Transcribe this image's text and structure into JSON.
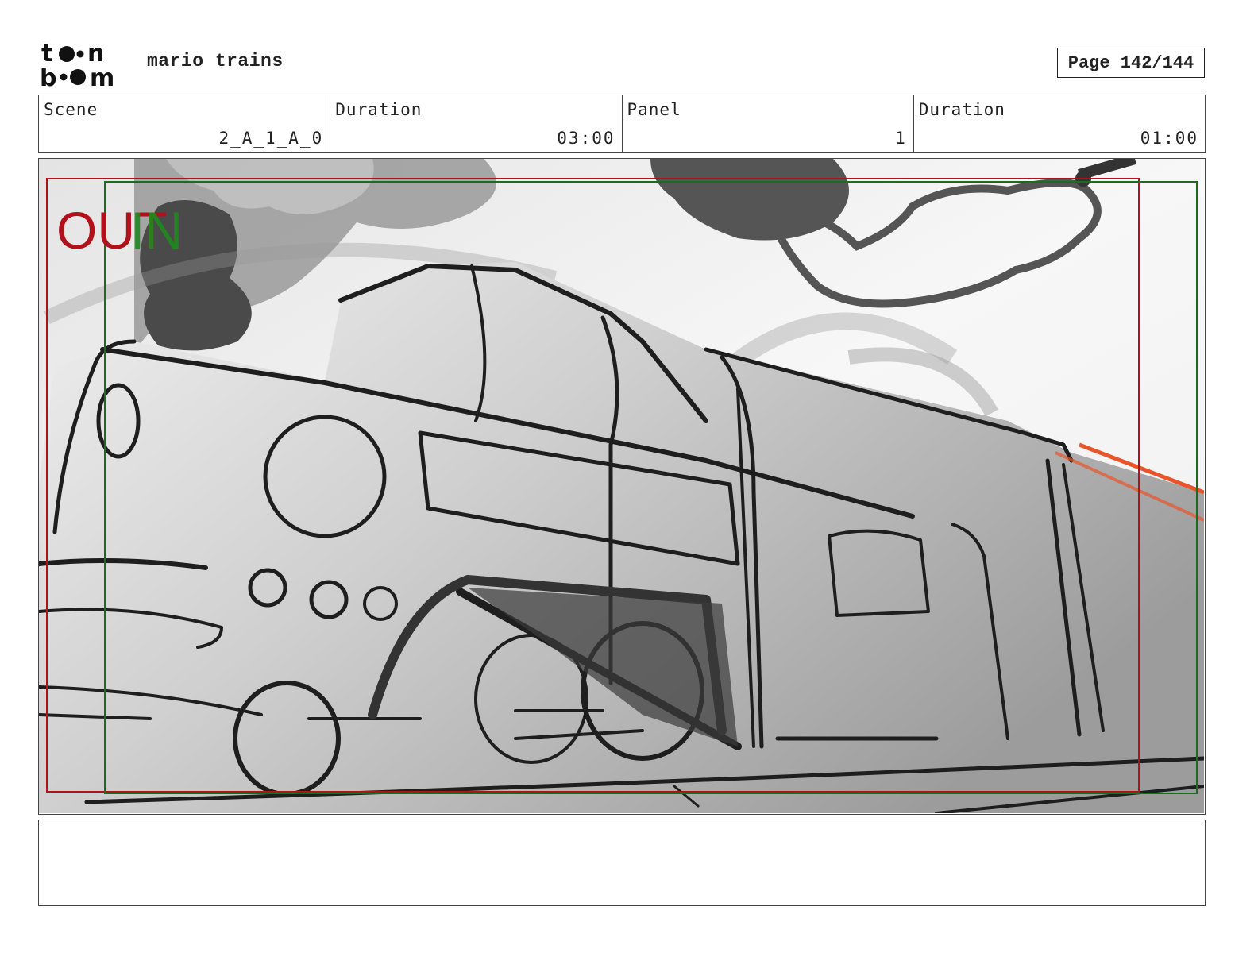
{
  "header": {
    "logo_text": "toon boom",
    "project_title": "mario trains",
    "page_label": "Page 142/144"
  },
  "info": {
    "scene_label": "Scene",
    "scene_value": "2_A_1_A_0",
    "scene_duration_label": "Duration",
    "scene_duration_value": "03:00",
    "panel_label": "Panel",
    "panel_value": "1",
    "panel_duration_label": "Duration",
    "panel_duration_value": "01:00"
  },
  "panel": {
    "out_label": "OUT",
    "in_label": "IN",
    "out_color": "#b0111a",
    "in_color": "#1f8a1f"
  },
  "notes": {
    "text": ""
  }
}
